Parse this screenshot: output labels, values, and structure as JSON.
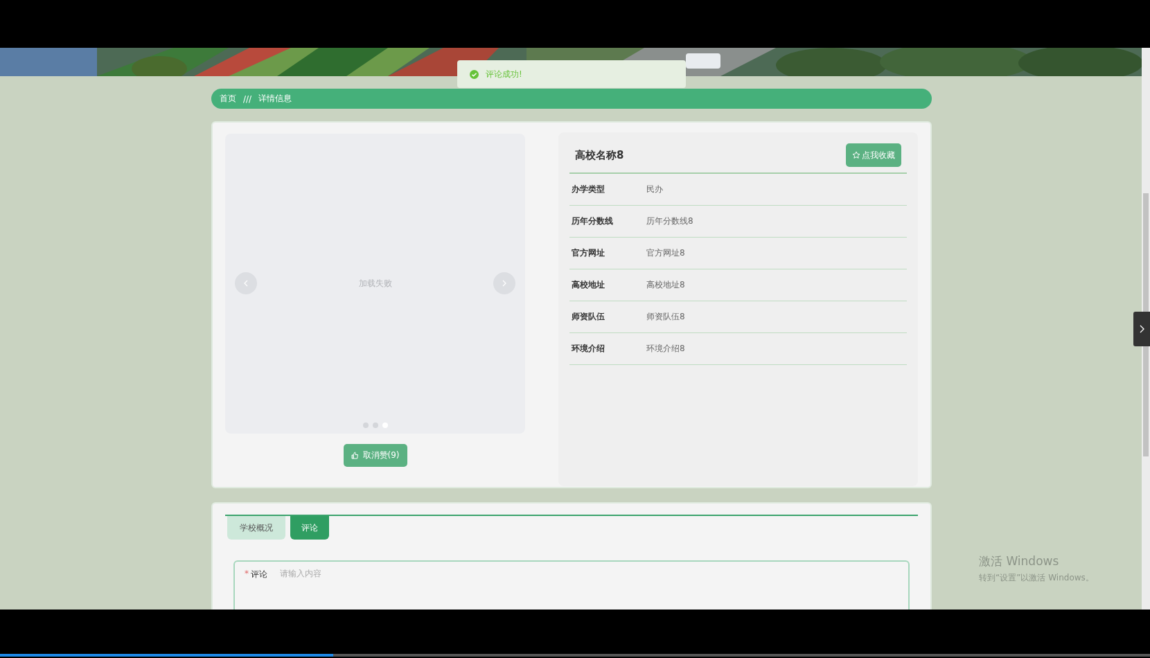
{
  "toast": {
    "text": "评论成功!"
  },
  "breadcrumb": [
    {
      "label": "首页"
    },
    {
      "label": "///"
    },
    {
      "label": "详情信息"
    }
  ],
  "carousel": {
    "message": "加载失败",
    "dots": [
      {
        "selected": false
      },
      {
        "selected": false
      },
      {
        "selected": true
      }
    ]
  },
  "like_button": {
    "label": "取消赞(9)"
  },
  "detail": {
    "title": "高校名称8",
    "favorite_button": "点我收藏",
    "fields": [
      {
        "label": "办学类型",
        "value": "民办"
      },
      {
        "label": "历年分数线",
        "value": "历年分数线8"
      },
      {
        "label": "官方网址",
        "value": "官方网址8"
      },
      {
        "label": "高校地址",
        "value": "高校地址8"
      },
      {
        "label": "师资队伍",
        "value": "师资队伍8"
      },
      {
        "label": "环境介绍",
        "value": "环境介绍8"
      }
    ]
  },
  "tabs": [
    {
      "label": "学校概况",
      "selected": false
    },
    {
      "label": "评论",
      "selected": true
    }
  ],
  "comment_form": {
    "required_mark": "*",
    "label": "评论",
    "placeholder": "请输入内容"
  },
  "os_notice": {
    "title": "激活 Windows",
    "subtitle": "转到“设置”以激活 Windows。"
  },
  "player": {
    "level": 0.29
  }
}
